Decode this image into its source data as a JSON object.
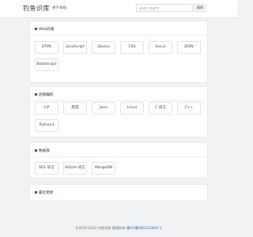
{
  "header": {
    "logo": "钓鱼识库",
    "nav_about": "关于本站",
    "search_placeholder": "请输入关键字",
    "search_button": "搜索"
  },
  "sections": [
    {
      "title": "Web前端",
      "items": [
        "HTML",
        "JavaScript",
        "jQuery",
        "CSS",
        "Vue.js",
        "JSON",
        "Bootstrap3"
      ]
    },
    {
      "title": "后端编程",
      "items": [
        "C#",
        "爬虫",
        "Java",
        "Linux",
        "C 语言",
        "C++",
        "Python3"
      ]
    },
    {
      "title": "数据库",
      "items": [
        "SQL 语言",
        "SQLite 语言",
        "MongoDB"
      ]
    },
    {
      "title": "最近更新",
      "items": []
    }
  ],
  "footer": {
    "copyright": "©2015-2022 钓鱼识库 版权所有",
    "icp": "豫ICP备09012336号-1"
  }
}
